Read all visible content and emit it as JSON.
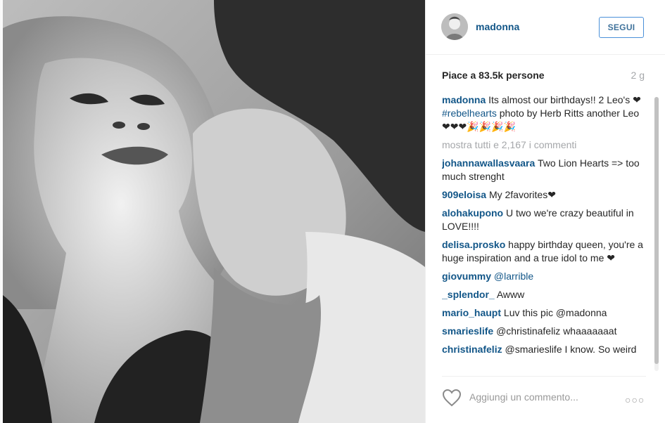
{
  "header": {
    "username": "madonna",
    "follow_label": "SEGUI",
    "avatar_icon": "avatar-madonna"
  },
  "likes": "Piace a 83.5k persone",
  "time_ago": "2 g",
  "caption": {
    "user": "madonna",
    "text_before": "Its almost our birthdays!! 2 Leo's ❤",
    "hashtag": "#rebelhearts",
    "text_after": " photo by Herb Ritts another Leo ❤❤❤🎉🎉🎉🎉"
  },
  "show_all": "mostra tutti e 2,167 i commenti",
  "comments": [
    {
      "user": "johannawallasvaara",
      "text": "Two Lion Hearts => too much strenght"
    },
    {
      "user": "909eloisa",
      "text": "My 2favorites❤"
    },
    {
      "user": "alohakupono",
      "text": "U two we're crazy beautiful in LOVE!!!!"
    },
    {
      "user": "delisa.prosko",
      "text": "happy birthday queen, you're a huge inspiration and a true idol to me ❤"
    },
    {
      "user": "giovummy",
      "text": "@larrible"
    },
    {
      "user": "_splendor_",
      "text": "Awww"
    },
    {
      "user": "mario_haupt",
      "text": "Luv this pic @madonna"
    },
    {
      "user": "smarieslife",
      "text": "@christinafeliz whaaaaaaat"
    },
    {
      "user": "christinafeliz",
      "text": "@smarieslife I know. So weird"
    }
  ],
  "add_comment_placeholder": "Aggiungi un commento...",
  "more_options": "○○○",
  "colors": {
    "username_blue": "#125688",
    "follow_border": "#4a90d9",
    "muted": "#a5a7aa"
  }
}
